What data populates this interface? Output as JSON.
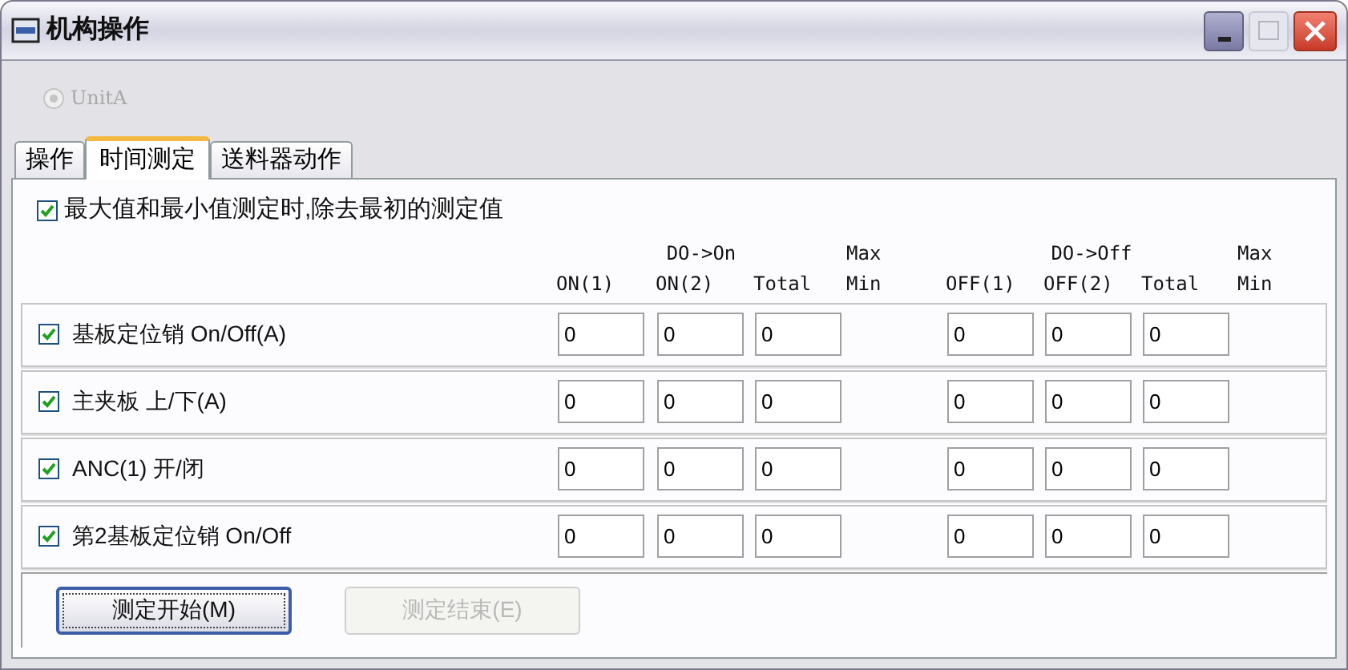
{
  "window": {
    "title": "机构操作"
  },
  "unit": {
    "label": "UnitA",
    "selected": true,
    "disabled": true
  },
  "tabs": [
    {
      "label": "操作",
      "selected": false
    },
    {
      "label": "时间测定",
      "selected": true
    },
    {
      "label": "送料器动作",
      "selected": false
    }
  ],
  "exclude_option": {
    "label": "最大值和最小值测定时,除去最初的测定值",
    "checked": true
  },
  "groups": [
    {
      "title": "DO->On",
      "columns": [
        "ON(1)",
        "ON(2)",
        "Total"
      ],
      "extreme": [
        "Max",
        "Min"
      ]
    },
    {
      "title": "DO->Off",
      "columns": [
        "OFF(1)",
        "OFF(2)",
        "Total"
      ],
      "extreme": [
        "Max",
        "Min"
      ]
    }
  ],
  "rows": [
    {
      "label": "基板定位销 On/Off(A)",
      "checked": true,
      "values": [
        "0",
        "0",
        "0",
        "0",
        "0",
        "0"
      ]
    },
    {
      "label": "主夹板 上/下(A)",
      "checked": true,
      "values": [
        "0",
        "0",
        "0",
        "0",
        "0",
        "0"
      ]
    },
    {
      "label": "ANC(1) 开/闭",
      "checked": true,
      "values": [
        "0",
        "0",
        "0",
        "0",
        "0",
        "0"
      ]
    },
    {
      "label": "第2基板定位销 On/Off",
      "checked": true,
      "values": [
        "0",
        "0",
        "0",
        "0",
        "0",
        "0"
      ]
    }
  ],
  "buttons": [
    {
      "label": "测定开始(M)",
      "disabled": false
    },
    {
      "label": "测定结束(E)",
      "disabled": true
    }
  ]
}
